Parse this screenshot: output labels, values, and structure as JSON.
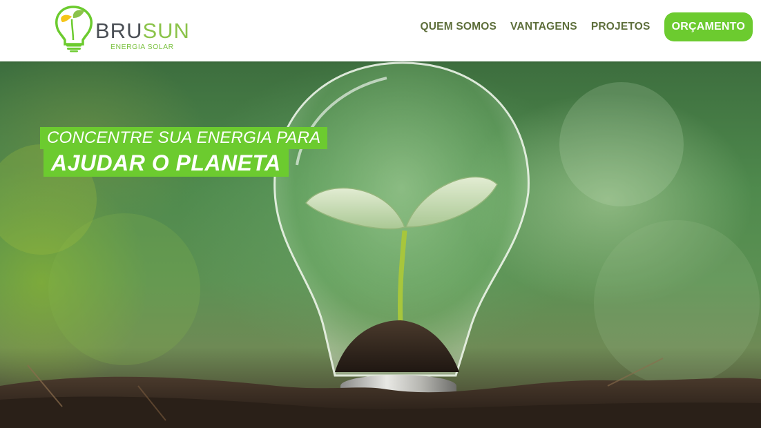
{
  "brand": {
    "name_part1": "BRU",
    "name_part2": "SUN",
    "tagline": "ENERGIA SOLAR",
    "logo_icon": "lightbulb-leaf-icon",
    "colors": {
      "green": "#6ccb2f",
      "gray": "#4a4f55",
      "yellow": "#f5c518"
    }
  },
  "nav": {
    "items": [
      {
        "label": "QUEM SOMOS"
      },
      {
        "label": "VANTAGENS"
      },
      {
        "label": "PROJETOS"
      }
    ],
    "cta_label": "ORÇAMENTO"
  },
  "hero": {
    "headline_line1": "CONCENTRE SUA ENERGIA PARA",
    "headline_line2": "AJUDAR O PLANETA",
    "image": "seedling-in-lightbulb-on-soil"
  }
}
